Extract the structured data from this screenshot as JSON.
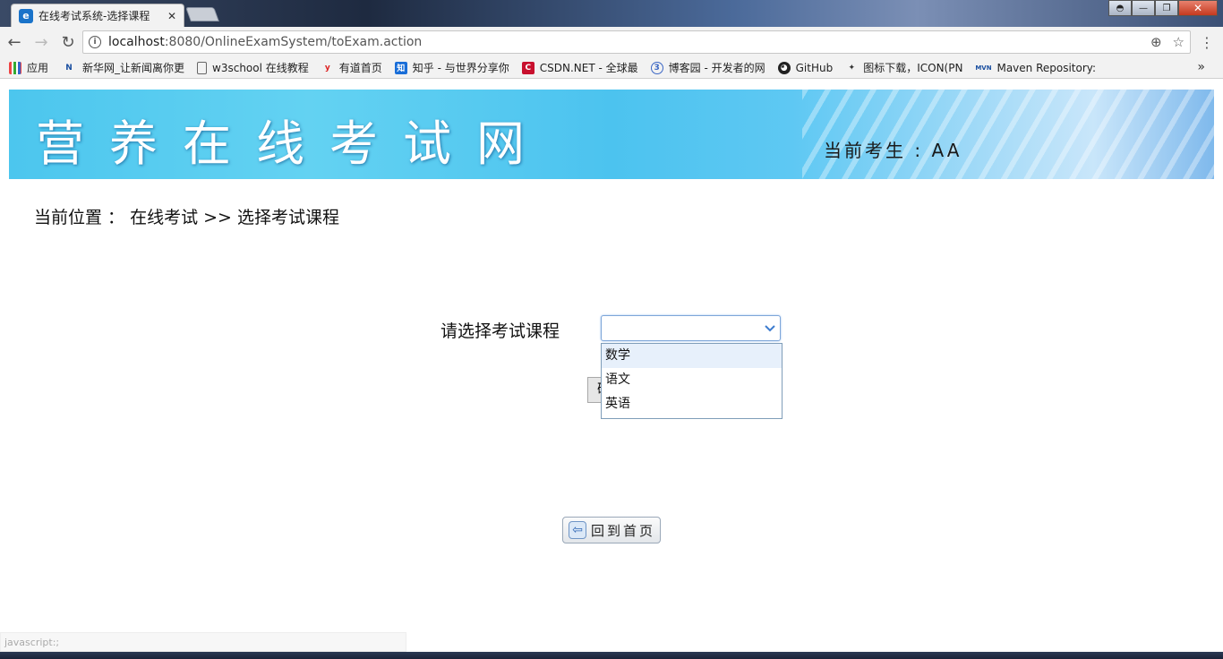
{
  "browser": {
    "tab_title": "在线考试系统-选择课程",
    "tab_favicon": "e",
    "tab_close": "✕",
    "window_minimize": "—",
    "window_maximize": "❐",
    "window_close": "✕",
    "back": "←",
    "forward": "→",
    "reload": "↻",
    "url_host": "localhost",
    "url_rest": ":8080/OnlineExamSystem/toExam.action",
    "zoom_icon": "⊕",
    "star_icon": "☆",
    "menu_icon": "⋮",
    "bookmarks": [
      {
        "label": "应用",
        "icon": "apps-grid-icon"
      },
      {
        "label": "新华网_让新闻离你更",
        "icon": "xinhua-news-icon"
      },
      {
        "label": "w3school 在线教程",
        "icon": "page-icon"
      },
      {
        "label": "有道首页",
        "icon": "youdao-icon"
      },
      {
        "label": "知乎 - 与世界分享你",
        "icon": "zhihu-icon"
      },
      {
        "label": "CSDN.NET - 全球最",
        "icon": "csdn-icon"
      },
      {
        "label": "博客园 - 开发者的网",
        "icon": "cnblogs-icon"
      },
      {
        "label": "GitHub",
        "icon": "github-icon"
      },
      {
        "label": "图标下载，ICON(PN",
        "icon": "icon-download-icon"
      },
      {
        "label": "Maven Repository:",
        "icon": "maven-icon"
      }
    ],
    "bookmarks_more": "»",
    "status_text": "javascript:;"
  },
  "header": {
    "title": "营养在线考试网",
    "current_user_label": "当前考生 : AA"
  },
  "breadcrumb": {
    "text": "当前位置 ： 在线考试 >> 选择考试课程"
  },
  "form": {
    "course_label": "请选择考试课程",
    "selected_value": "",
    "options": [
      "数学",
      "语文",
      "英语"
    ],
    "confirm_partial": "确"
  },
  "home_button": {
    "label": "回到首页"
  }
}
